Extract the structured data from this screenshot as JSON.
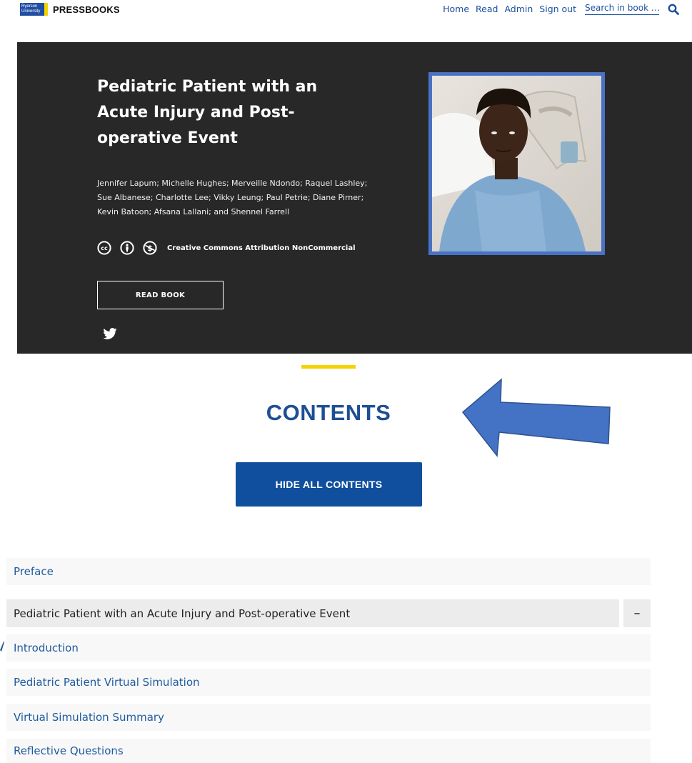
{
  "header": {
    "logo_badge_line1": "Ryerson",
    "logo_badge_line2": "University",
    "logo_text": "PRESSBOOKS",
    "nav": [
      "Home",
      "Read",
      "Admin",
      "Sign out"
    ],
    "search_placeholder": "Search in book …",
    "search_icon": "search-icon"
  },
  "hero": {
    "title": "Pediatric Patient with an Acute Injury and Post-operative Event",
    "authors": "Jennifer Lapum; Michelle Hughes; Merveille Ndondo; Raquel Lashley; Sue Albanese; Charlotte Lee; Vikky Leung; Paul Petrie; Diane Pirner; Kevin Batoon; Afsana Lallani; and Shennel Farrell",
    "license_icons": [
      "cc-icon",
      "attribution-icon",
      "noncommercial-icon"
    ],
    "license_label": "Creative Commons Attribution NonCommercial",
    "read_button": "READ BOOK",
    "social_icon": "twitter-icon"
  },
  "contents": {
    "title": "CONTENTS",
    "toggle_button": "HIDE ALL CONTENTS",
    "items": [
      {
        "label": "Preface"
      },
      {
        "label": "Pediatric Patient with an Acute Injury and Post-operative Event",
        "toggle": "–"
      },
      {
        "label": "Introduction"
      },
      {
        "label": "Pediatric Patient Virtual Simulation"
      },
      {
        "label": "Virtual Simulation Summary"
      },
      {
        "label": "Reflective Questions"
      }
    ]
  },
  "colors": {
    "brand_blue": "#0f4f9e",
    "hero_bg": "#282828",
    "accent_yellow": "#f5d300",
    "annotation_arrow": "#4472c4"
  }
}
